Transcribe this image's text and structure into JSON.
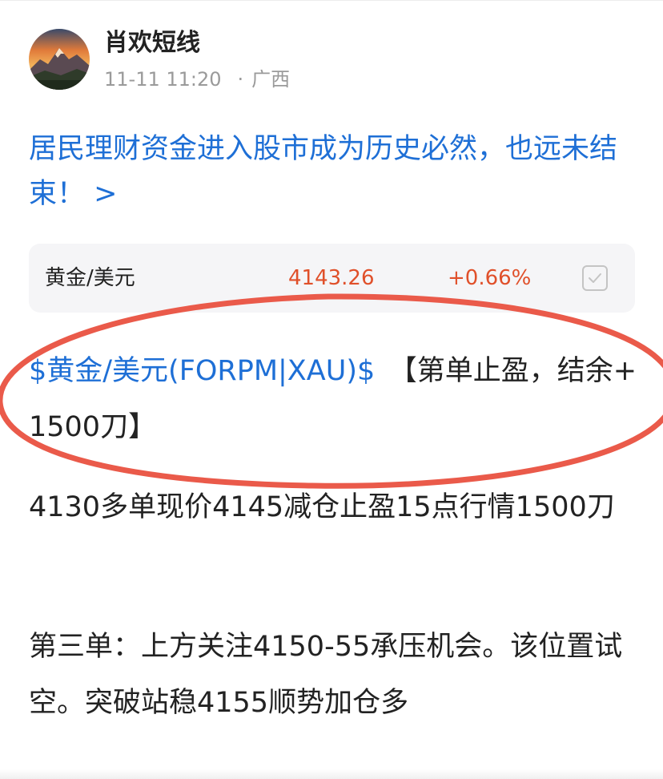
{
  "post": {
    "author": "肖欢短线",
    "datetime": "11-11 11:20",
    "separator": "·",
    "location": "广西",
    "article_link": "居民理财资金进入股市成为历史必然，也远未结束！ >"
  },
  "quote": {
    "name": "黄金/美元",
    "price": "4143.26",
    "change": "+0.66%",
    "check_icon": "checkbox-check-icon"
  },
  "content": {
    "stock_tag": "$黄金/美元(FORPM|XAU)$",
    "para1_rest": "　【第单止盈，结余+ 1500刀】",
    "para2": "4130多单现价4145减仓止盈15点行情1500刀",
    "para3": "第三单：上方关注4150-55承压机会。该位置试空。突破站稳4155顺势加仓多"
  },
  "colors": {
    "link_blue": "#1e6fd6",
    "price_red": "#e0502a",
    "annotation_red": "#ea5a4a",
    "text": "#222222",
    "meta_gray": "#9a9a9a",
    "card_bg": "#f5f5f7"
  },
  "icons": {
    "avatar": "mountain-sunset-avatar",
    "checkbox": "checkbox-check-icon"
  }
}
